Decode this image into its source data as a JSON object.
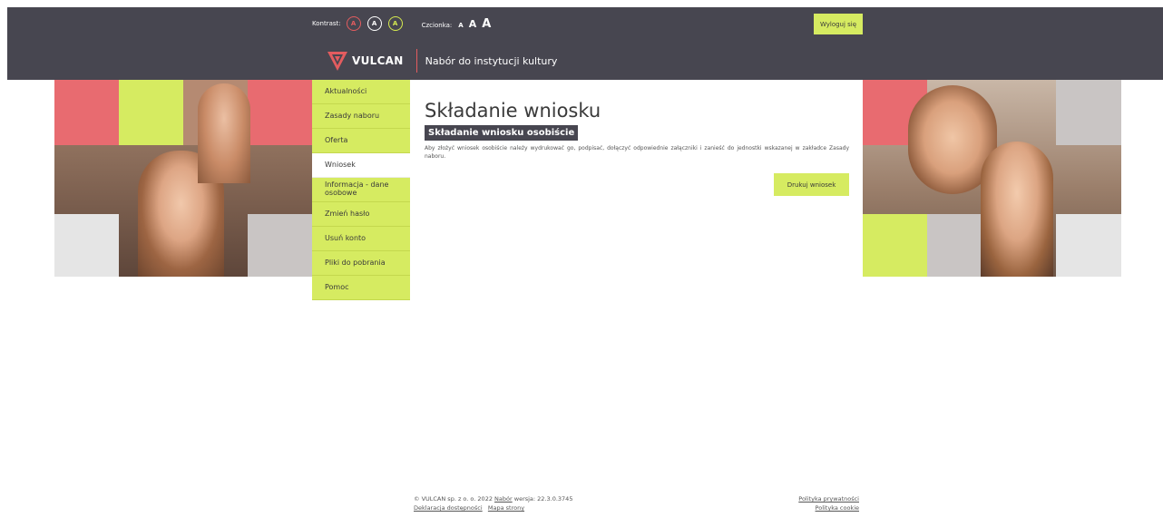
{
  "accessibility": {
    "contrast_label": "Kontrast:",
    "contrast_options": [
      "A",
      "A",
      "A"
    ],
    "font_label": "Czcionka:",
    "font_options": [
      "A",
      "A",
      "A"
    ]
  },
  "header": {
    "logout_label": "Wyloguj się",
    "logo_text": "VULCAN",
    "app_title": "Nabór do instytucji kultury"
  },
  "menu": {
    "items": [
      {
        "label": "Aktualności"
      },
      {
        "label": "Zasady naboru"
      },
      {
        "label": "Oferta"
      },
      {
        "label": "Wniosek"
      },
      {
        "label": "Informacja - dane osobowe"
      },
      {
        "label": "Zmień hasło"
      },
      {
        "label": "Usuń konto"
      },
      {
        "label": "Pliki do pobrania"
      },
      {
        "label": "Pomoc"
      }
    ],
    "active": "Wniosek"
  },
  "main": {
    "title": "Składanie wniosku",
    "section_title": "Składanie wniosku osobiście",
    "description": "Aby złożyć wniosek osobiście należy wydrukować go, podpisać, dołączyć odpowiednie załączniki i zanieść do jednostki wskazanej w zakładce Zasady naboru.",
    "print_button": "Drukuj wniosek"
  },
  "footer": {
    "copyright": "© VULCAN sp. z o. o. 2022",
    "nabor_link": "Nabór",
    "version_text": "wersja: 22.3.0.3745",
    "accessibility_link": "Deklaracja dostępności",
    "sitemap_link": "Mapa strony",
    "privacy_link": "Polityka prywatności",
    "cookie_link": "Polityka cookie"
  },
  "colors": {
    "header_bg": "#474650",
    "accent_lime": "#d6eb61",
    "accent_red": "#e35c5f"
  }
}
